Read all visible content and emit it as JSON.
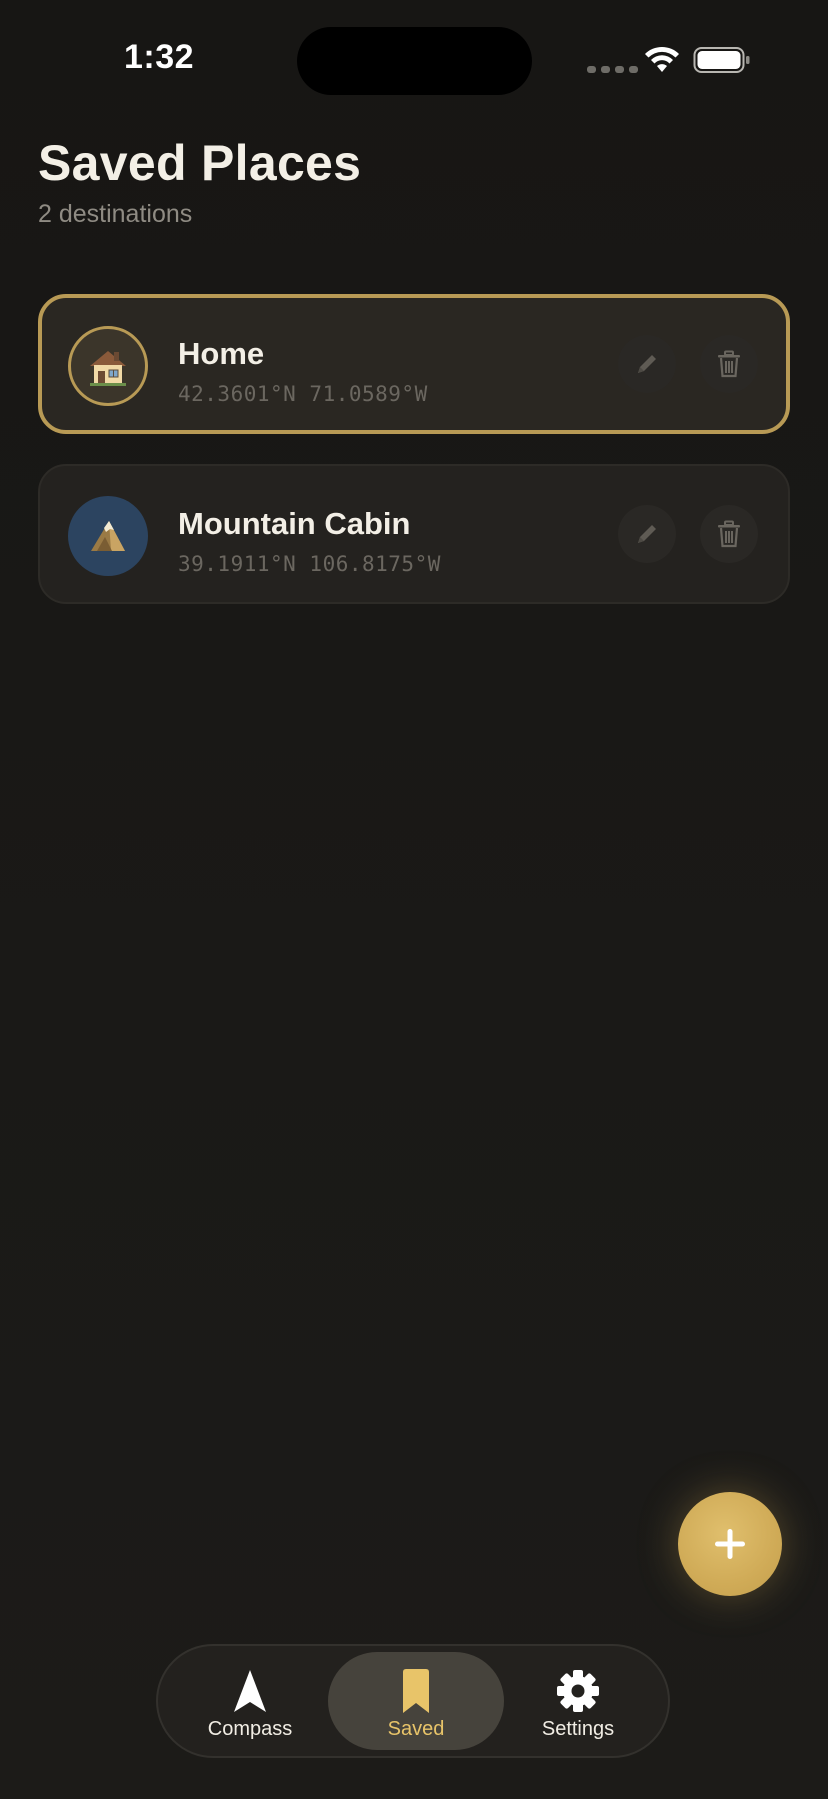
{
  "status_bar": {
    "time": "1:32"
  },
  "header": {
    "title": "Saved Places",
    "subtitle": "2 destinations"
  },
  "places": [
    {
      "name": "Home",
      "coords": "42.3601°N 71.0589°W",
      "icon": "house-icon",
      "selected": true
    },
    {
      "name": "Mountain Cabin",
      "coords": "39.1911°N 106.8175°W",
      "icon": "mountain-icon",
      "selected": false
    }
  ],
  "fab": {
    "icon": "plus-icon"
  },
  "tab_bar": {
    "tabs": [
      {
        "label": "Compass",
        "icon": "compass-arrow-icon",
        "active": false
      },
      {
        "label": "Saved",
        "icon": "bookmark-icon",
        "active": true
      },
      {
        "label": "Settings",
        "icon": "gear-icon",
        "active": false
      }
    ]
  },
  "colors": {
    "background": "#181715",
    "accent_gold": "#b89a55",
    "fab_gold": "#d4af5a",
    "active_tab_label": "#e8c469"
  }
}
